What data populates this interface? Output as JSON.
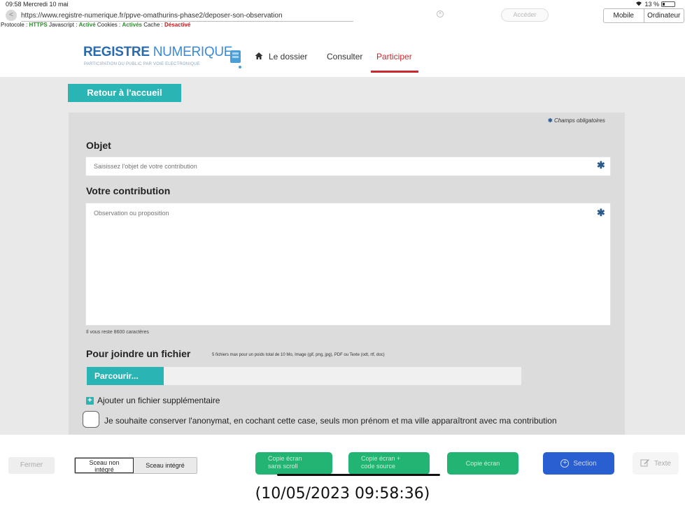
{
  "status_bar": {
    "time_date": "09:58  Mercredi 10 mai",
    "battery_text": "13 %"
  },
  "browser": {
    "url": "https://www.registre-numerique.fr/ppve-omathurins-phase2/deposer-son-observation",
    "go_label": "Accéder",
    "modes": [
      "Mobile",
      "Ordinateur"
    ],
    "info": {
      "protocol_label": "Protocole :",
      "protocol_value": "HTTPS",
      "javascript_label": "Javascript :",
      "javascript_value": "Activé",
      "cookies_label": "Cookies :",
      "cookies_value": "Activés",
      "cache_label": "Cache :",
      "cache_value": "Désactivé"
    }
  },
  "site": {
    "logo_main": "REGISTRE",
    "logo_secondary": "NUMERIQUE",
    "logo_tagline": "PARTICIPATION DU PUBLIC PAR VOIE ELECTRONIQUE",
    "nav": [
      "Le dossier",
      "Consulter",
      "Participer"
    ],
    "active_nav": "Participer"
  },
  "page": {
    "back_home": "Retour à l'accueil",
    "required_note": "Champs obligatoires",
    "objet_label": "Objet",
    "objet_placeholder": "Saisissez l'objet de votre contribution",
    "contribution_label": "Votre contribution",
    "contribution_placeholder": "Observation ou proposition",
    "chars_left": "Il vous reste 8600 caractères",
    "file_label": "Pour joindre un fichier",
    "file_hint": "5 fichiers max pour un poids total de 10 Mo, Image (gif, png, jpg), PDF ou Texte (odt, rtf, doc)",
    "browse_label": "Parcourir...",
    "add_file_label": "Ajouter un fichier supplémentaire",
    "anonymity_label": "Je souhaite conserver l'anonymat, en cochant cette case, seuls mon prénom et ma ville apparaîtront avec ma contribution"
  },
  "toolbar": {
    "close_label": "Fermer",
    "seal_non_line1": "Sceau non",
    "seal_non_line2": "intégré",
    "seal_integre": "Sceau intégré",
    "shot_noscroll_line1": "Copie écran",
    "shot_noscroll_line2": "sans scroll",
    "shot_source_line1": "Copie écran +",
    "shot_source_line2": "code source",
    "shot_plain": "Copie écran",
    "section_label": "Section",
    "text_label": "Texte"
  },
  "timestamp": "(10/05/2023 09:58:36)",
  "icons": [
    "back-arrow-icon",
    "wifi-icon",
    "battery-icon",
    "clear-icon",
    "logo-icon",
    "home-icon",
    "asterisk-icon",
    "plus-square-icon",
    "plus-circle-icon",
    "edit-icon"
  ],
  "colors": {
    "teal": "#2bb4b4",
    "brand_blue": "#2a6bb0",
    "active_red": "#c8282e",
    "green": "#22b472",
    "section_blue": "#2a5fd2"
  }
}
